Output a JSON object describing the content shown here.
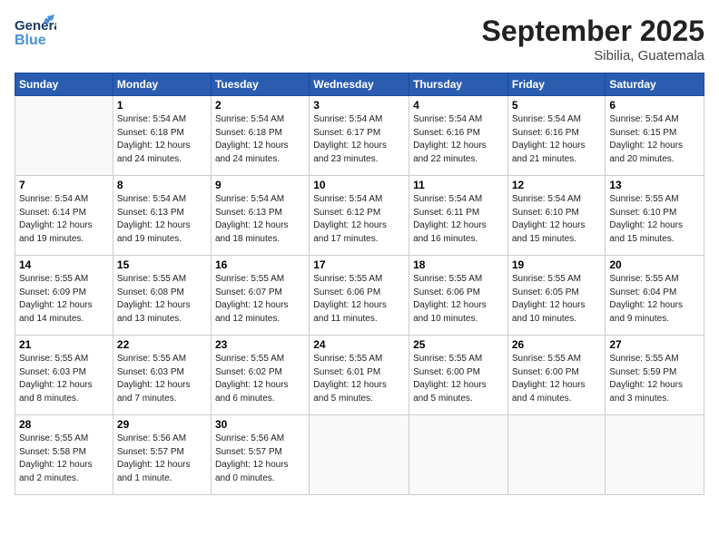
{
  "logo": {
    "line1": "General",
    "line2": "Blue"
  },
  "header": {
    "month": "September 2025",
    "location": "Sibilia, Guatemala"
  },
  "weekdays": [
    "Sunday",
    "Monday",
    "Tuesday",
    "Wednesday",
    "Thursday",
    "Friday",
    "Saturday"
  ],
  "weeks": [
    [
      {
        "day": "",
        "info": ""
      },
      {
        "day": "1",
        "info": "Sunrise: 5:54 AM\nSunset: 6:18 PM\nDaylight: 12 hours\nand 24 minutes."
      },
      {
        "day": "2",
        "info": "Sunrise: 5:54 AM\nSunset: 6:18 PM\nDaylight: 12 hours\nand 24 minutes."
      },
      {
        "day": "3",
        "info": "Sunrise: 5:54 AM\nSunset: 6:17 PM\nDaylight: 12 hours\nand 23 minutes."
      },
      {
        "day": "4",
        "info": "Sunrise: 5:54 AM\nSunset: 6:16 PM\nDaylight: 12 hours\nand 22 minutes."
      },
      {
        "day": "5",
        "info": "Sunrise: 5:54 AM\nSunset: 6:16 PM\nDaylight: 12 hours\nand 21 minutes."
      },
      {
        "day": "6",
        "info": "Sunrise: 5:54 AM\nSunset: 6:15 PM\nDaylight: 12 hours\nand 20 minutes."
      }
    ],
    [
      {
        "day": "7",
        "info": "Sunrise: 5:54 AM\nSunset: 6:14 PM\nDaylight: 12 hours\nand 19 minutes."
      },
      {
        "day": "8",
        "info": "Sunrise: 5:54 AM\nSunset: 6:13 PM\nDaylight: 12 hours\nand 19 minutes."
      },
      {
        "day": "9",
        "info": "Sunrise: 5:54 AM\nSunset: 6:13 PM\nDaylight: 12 hours\nand 18 minutes."
      },
      {
        "day": "10",
        "info": "Sunrise: 5:54 AM\nSunset: 6:12 PM\nDaylight: 12 hours\nand 17 minutes."
      },
      {
        "day": "11",
        "info": "Sunrise: 5:54 AM\nSunset: 6:11 PM\nDaylight: 12 hours\nand 16 minutes."
      },
      {
        "day": "12",
        "info": "Sunrise: 5:54 AM\nSunset: 6:10 PM\nDaylight: 12 hours\nand 15 minutes."
      },
      {
        "day": "13",
        "info": "Sunrise: 5:55 AM\nSunset: 6:10 PM\nDaylight: 12 hours\nand 15 minutes."
      }
    ],
    [
      {
        "day": "14",
        "info": "Sunrise: 5:55 AM\nSunset: 6:09 PM\nDaylight: 12 hours\nand 14 minutes."
      },
      {
        "day": "15",
        "info": "Sunrise: 5:55 AM\nSunset: 6:08 PM\nDaylight: 12 hours\nand 13 minutes."
      },
      {
        "day": "16",
        "info": "Sunrise: 5:55 AM\nSunset: 6:07 PM\nDaylight: 12 hours\nand 12 minutes."
      },
      {
        "day": "17",
        "info": "Sunrise: 5:55 AM\nSunset: 6:06 PM\nDaylight: 12 hours\nand 11 minutes."
      },
      {
        "day": "18",
        "info": "Sunrise: 5:55 AM\nSunset: 6:06 PM\nDaylight: 12 hours\nand 10 minutes."
      },
      {
        "day": "19",
        "info": "Sunrise: 5:55 AM\nSunset: 6:05 PM\nDaylight: 12 hours\nand 10 minutes."
      },
      {
        "day": "20",
        "info": "Sunrise: 5:55 AM\nSunset: 6:04 PM\nDaylight: 12 hours\nand 9 minutes."
      }
    ],
    [
      {
        "day": "21",
        "info": "Sunrise: 5:55 AM\nSunset: 6:03 PM\nDaylight: 12 hours\nand 8 minutes."
      },
      {
        "day": "22",
        "info": "Sunrise: 5:55 AM\nSunset: 6:03 PM\nDaylight: 12 hours\nand 7 minutes."
      },
      {
        "day": "23",
        "info": "Sunrise: 5:55 AM\nSunset: 6:02 PM\nDaylight: 12 hours\nand 6 minutes."
      },
      {
        "day": "24",
        "info": "Sunrise: 5:55 AM\nSunset: 6:01 PM\nDaylight: 12 hours\nand 5 minutes."
      },
      {
        "day": "25",
        "info": "Sunrise: 5:55 AM\nSunset: 6:00 PM\nDaylight: 12 hours\nand 5 minutes."
      },
      {
        "day": "26",
        "info": "Sunrise: 5:55 AM\nSunset: 6:00 PM\nDaylight: 12 hours\nand 4 minutes."
      },
      {
        "day": "27",
        "info": "Sunrise: 5:55 AM\nSunset: 5:59 PM\nDaylight: 12 hours\nand 3 minutes."
      }
    ],
    [
      {
        "day": "28",
        "info": "Sunrise: 5:55 AM\nSunset: 5:58 PM\nDaylight: 12 hours\nand 2 minutes."
      },
      {
        "day": "29",
        "info": "Sunrise: 5:56 AM\nSunset: 5:57 PM\nDaylight: 12 hours\nand 1 minute."
      },
      {
        "day": "30",
        "info": "Sunrise: 5:56 AM\nSunset: 5:57 PM\nDaylight: 12 hours\nand 0 minutes."
      },
      {
        "day": "",
        "info": ""
      },
      {
        "day": "",
        "info": ""
      },
      {
        "day": "",
        "info": ""
      },
      {
        "day": "",
        "info": ""
      }
    ]
  ]
}
